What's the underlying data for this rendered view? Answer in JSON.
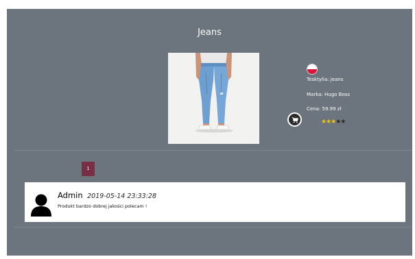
{
  "product": {
    "title": "Jeans",
    "image_alt": "Jeans",
    "flag_icon": "poland-flag-icon",
    "material": "Tesktylia: jeans",
    "brand": "Marka: Hugo Boss",
    "price": "Cena: 59.99 zł",
    "rating": 3,
    "rating_max": 5,
    "stars_filled": "★★★",
    "stars_empty": "★★"
  },
  "cart_button": {
    "icon": "cart-icon"
  },
  "pagination": {
    "current_page": "1"
  },
  "comments": [
    {
      "author": "Admin",
      "timestamp": "2019-05-14 23:33:28",
      "text": "Produkt bardzo dobrej jakości polecam !"
    }
  ],
  "colors": {
    "panel": "#6c757d",
    "page_button": "#7a2e45",
    "star_on": "#f3c20f",
    "star_off": "#2a2a2a"
  }
}
